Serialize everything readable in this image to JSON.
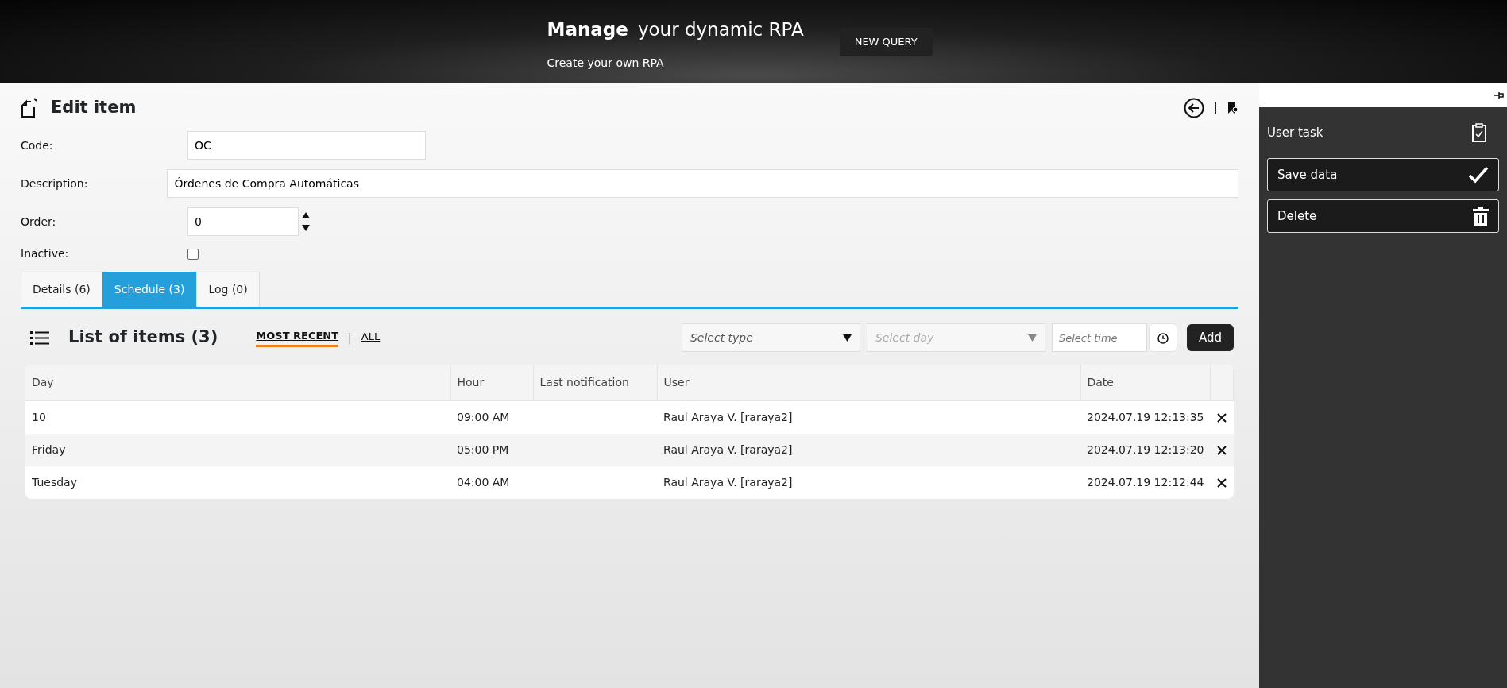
{
  "banner": {
    "title_bold": "Manage",
    "title": "your dynamic RPA",
    "subtitle": "Create your own RPA",
    "button": "NEW QUERY"
  },
  "page": {
    "title": "Edit item"
  },
  "form": {
    "code": {
      "label": "Code:",
      "value": "OC"
    },
    "description": {
      "label": "Description:",
      "value": "Órdenes de Compra Automáticas"
    },
    "order": {
      "label": "Order:",
      "value": "0"
    },
    "inactive": {
      "label": "Inactive:",
      "checked": false
    }
  },
  "tabs": [
    {
      "label": "Details (6)",
      "selected": false
    },
    {
      "label": "Schedule (3)",
      "selected": true
    },
    {
      "label": "Log (0)",
      "selected": false
    }
  ],
  "list": {
    "title": "List of items (3)",
    "filters": [
      {
        "label": "MOST RECENT",
        "selected": true
      },
      {
        "label": "ALL",
        "selected": false
      }
    ],
    "filter_separator": "|",
    "type_select": {
      "placeholder": "Select type",
      "disabled": false
    },
    "day_select": {
      "placeholder": "Select day",
      "disabled": true
    },
    "time_field": {
      "placeholder": "Select time"
    },
    "add_button": "Add"
  },
  "table": {
    "columns": [
      "Day",
      "Hour",
      "Last notification",
      "User",
      "Date"
    ],
    "rows": [
      [
        "10",
        "09:00 AM",
        "",
        "Raul Araya V. [raraya2]",
        "2024.07.19 12:13:35"
      ],
      [
        "Friday",
        "05:00 PM",
        "",
        "Raul Araya V. [raraya2]",
        "2024.07.19 12:13:20"
      ],
      [
        "Tuesday",
        "04:00 AM",
        "",
        "Raul Araya V. [raraya2]",
        "2024.07.19 12:12:44"
      ]
    ]
  },
  "sidebar": {
    "title": "User task",
    "actions": [
      {
        "label": "Save data",
        "kind": "save"
      },
      {
        "label": "Delete",
        "kind": "delete"
      }
    ]
  }
}
